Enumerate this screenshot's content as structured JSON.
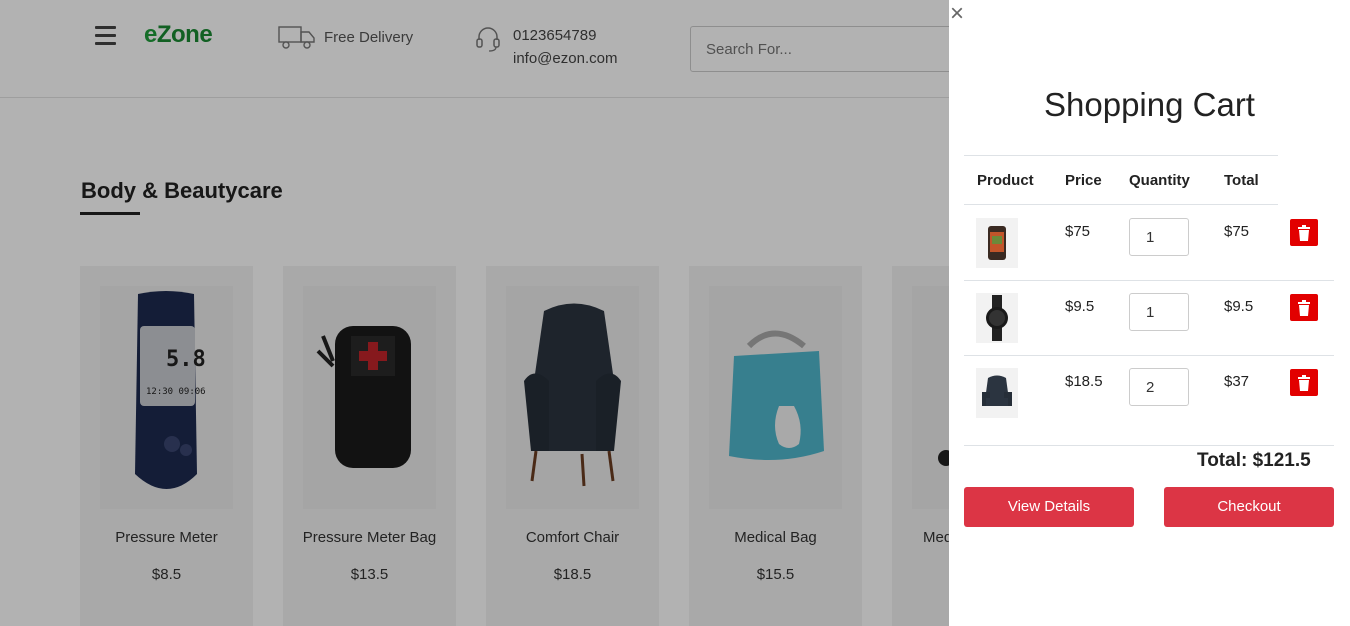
{
  "header": {
    "logo_e": "e",
    "logo_rest": "Zone",
    "delivery_label": "Free Delivery",
    "phone": "0123654789",
    "email": "info@ezon.com",
    "search_placeholder": "Search For..."
  },
  "section": {
    "title": "Body & Beautycare"
  },
  "products": [
    {
      "name": "Pressure Meter",
      "price": "$8.5",
      "icon": "pressure-meter-image"
    },
    {
      "name": "Pressure Meter Bag",
      "price": "$13.5",
      "icon": "pressure-meter-bag-image"
    },
    {
      "name": "Comfort Chair",
      "price": "$18.5",
      "icon": "comfort-chair-image"
    },
    {
      "name": "Medical Bag",
      "price": "$15.5",
      "icon": "medical-bag-image"
    },
    {
      "name": "Med",
      "price": "",
      "icon": "partial-product-image"
    }
  ],
  "cart": {
    "title": "Shopping Cart",
    "close_glyph": "×",
    "columns": [
      "Product",
      "Price",
      "Quantity",
      "Total"
    ],
    "items": [
      {
        "price": "$75",
        "quantity": "1",
        "total": "$75",
        "icon": "bag-thumbnail"
      },
      {
        "price": "$9.5",
        "quantity": "1",
        "total": "$9.5",
        "icon": "watch-thumbnail"
      },
      {
        "price": "$18.5",
        "quantity": "2",
        "total": "$37",
        "icon": "chair-thumbnail"
      }
    ],
    "grand_total": "Total: $121.5",
    "view_details_label": "View Details",
    "checkout_label": "Checkout",
    "delete_color": "#e20000",
    "button_color": "#dc3545"
  }
}
